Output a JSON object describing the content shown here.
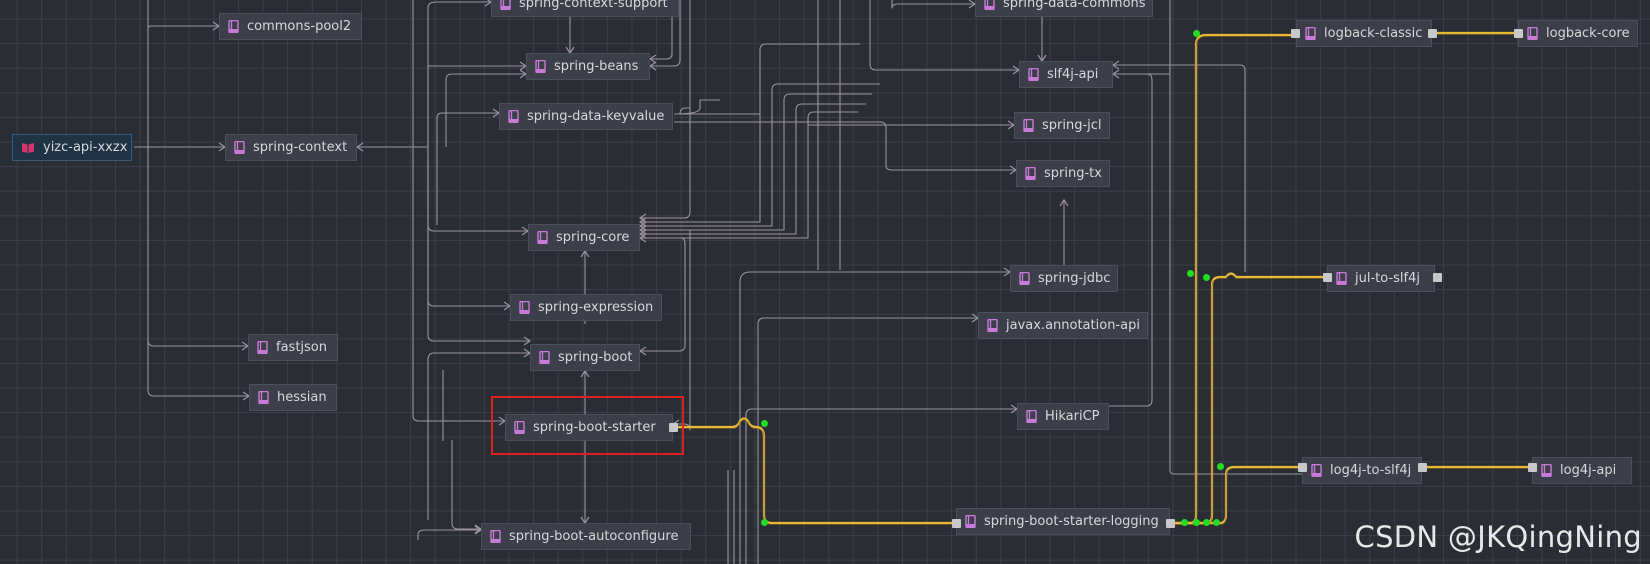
{
  "watermark": "CSDN @JKQingNing",
  "colors": {
    "background": "#2b2d35",
    "edge": "#9c93a1",
    "highlight_edge": "#e6b83a",
    "selection": "#e02020",
    "node_icon": "#c77bd6",
    "root_icon": "#d4356b"
  },
  "nodes": [
    {
      "id": "spring-context-support-partial",
      "label": "spring-context-support",
      "icon": "library-icon"
    },
    {
      "id": "commons-pool2",
      "label": "commons-pool2",
      "icon": "library-icon"
    },
    {
      "id": "spring-data-commons",
      "label": "spring-data-commons",
      "icon": "library-icon"
    },
    {
      "id": "logback-classic",
      "label": "logback-classic",
      "icon": "library-icon"
    },
    {
      "id": "logback-core",
      "label": "logback-core",
      "icon": "library-icon"
    },
    {
      "id": "spring-beans",
      "label": "spring-beans",
      "icon": "library-icon"
    },
    {
      "id": "slf4j-api",
      "label": "slf4j-api",
      "icon": "library-icon"
    },
    {
      "id": "spring-data-keyvalue",
      "label": "spring-data-keyvalue",
      "icon": "library-icon"
    },
    {
      "id": "spring-jcl",
      "label": "spring-jcl",
      "icon": "library-icon"
    },
    {
      "id": "yizc-api-xxzx",
      "label": "yizc-api-xxzx",
      "icon": "project-icon"
    },
    {
      "id": "spring-context",
      "label": "spring-context",
      "icon": "library-icon"
    },
    {
      "id": "spring-tx",
      "label": "spring-tx",
      "icon": "library-icon"
    },
    {
      "id": "spring-core",
      "label": "spring-core",
      "icon": "library-icon"
    },
    {
      "id": "spring-jdbc",
      "label": "spring-jdbc",
      "icon": "library-icon"
    },
    {
      "id": "jul-to-slf4j",
      "label": "jul-to-slf4j",
      "icon": "library-icon"
    },
    {
      "id": "spring-expression",
      "label": "spring-expression",
      "icon": "library-icon"
    },
    {
      "id": "javax.annotation-api",
      "label": "javax.annotation-api",
      "icon": "library-icon"
    },
    {
      "id": "fastjson",
      "label": "fastjson",
      "icon": "library-icon"
    },
    {
      "id": "spring-boot",
      "label": "spring-boot",
      "icon": "library-icon"
    },
    {
      "id": "hessian",
      "label": "hessian",
      "icon": "library-icon"
    },
    {
      "id": "HikariCP",
      "label": "HikariCP",
      "icon": "library-icon"
    },
    {
      "id": "spring-boot-starter",
      "label": "spring-boot-starter",
      "icon": "library-icon",
      "selected": true
    },
    {
      "id": "log4j-to-slf4j",
      "label": "log4j-to-slf4j",
      "icon": "library-icon"
    },
    {
      "id": "log4j-api",
      "label": "log4j-api",
      "icon": "library-icon"
    },
    {
      "id": "spring-boot-starter-logging",
      "label": "spring-boot-starter-logging",
      "icon": "library-icon"
    },
    {
      "id": "spring-boot-autoconfigure",
      "label": "spring-boot-autoconfigure",
      "icon": "library-icon"
    }
  ],
  "dependencies": [
    {
      "from": "yizc-api-xxzx",
      "to": "commons-pool2"
    },
    {
      "from": "yizc-api-xxzx",
      "to": "spring-context"
    },
    {
      "from": "yizc-api-xxzx",
      "to": "fastjson"
    },
    {
      "from": "yizc-api-xxzx",
      "to": "hessian"
    },
    {
      "from": "spring-context",
      "to": "spring-beans"
    },
    {
      "from": "spring-context",
      "to": "spring-core"
    },
    {
      "from": "spring-context",
      "to": "spring-expression"
    },
    {
      "from": "spring-boot-starter",
      "to": "spring-boot"
    },
    {
      "from": "spring-boot-starter",
      "to": "spring-boot-autoconfigure"
    },
    {
      "from": "spring-boot-starter",
      "to": "javax.annotation-api"
    },
    {
      "from": "spring-boot-starter",
      "to": "spring-core"
    },
    {
      "from": "spring-boot-starter",
      "to": "spring-boot-starter-logging",
      "highlight": true
    },
    {
      "from": "spring-boot-starter-logging",
      "to": "logback-classic",
      "highlight": true
    },
    {
      "from": "spring-boot-starter-logging",
      "to": "jul-to-slf4j",
      "highlight": true
    },
    {
      "from": "spring-boot-starter-logging",
      "to": "log4j-to-slf4j",
      "highlight": true
    },
    {
      "from": "logback-classic",
      "to": "logback-core",
      "highlight": true
    },
    {
      "from": "log4j-to-slf4j",
      "to": "log4j-api",
      "highlight": true
    },
    {
      "from": "logback-classic",
      "to": "slf4j-api"
    },
    {
      "from": "jul-to-slf4j",
      "to": "slf4j-api"
    },
    {
      "from": "HikariCP",
      "to": "slf4j-api"
    },
    {
      "from": "spring-data-keyvalue",
      "to": "spring-data-commons"
    },
    {
      "from": "spring-data-keyvalue",
      "to": "spring-tx"
    },
    {
      "from": "spring-data-commons",
      "to": "slf4j-api"
    },
    {
      "from": "spring-jdbc",
      "to": "spring-tx"
    },
    {
      "from": "spring-core",
      "to": "spring-jcl"
    },
    {
      "from": "spring-beans",
      "to": "spring-core"
    },
    {
      "from": "spring-expression",
      "to": "spring-core"
    },
    {
      "from": "spring-boot",
      "to": "spring-core"
    }
  ]
}
